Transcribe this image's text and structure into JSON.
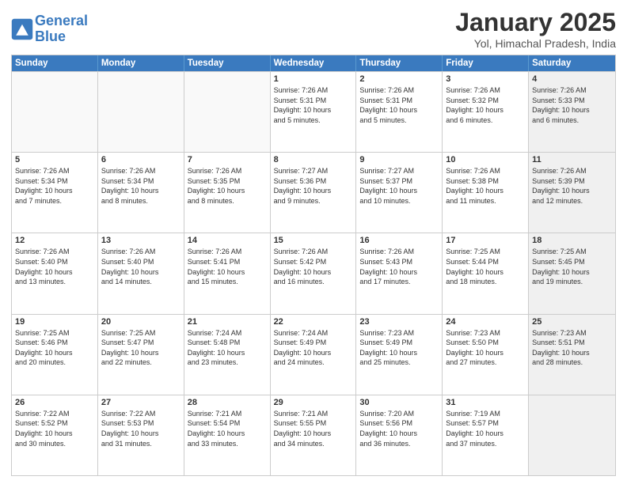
{
  "header": {
    "logo_line1": "General",
    "logo_line2": "Blue",
    "title": "January 2025",
    "subtitle": "Yol, Himachal Pradesh, India"
  },
  "weekdays": [
    "Sunday",
    "Monday",
    "Tuesday",
    "Wednesday",
    "Thursday",
    "Friday",
    "Saturday"
  ],
  "weeks": [
    [
      {
        "day": "",
        "info": "",
        "empty": true
      },
      {
        "day": "",
        "info": "",
        "empty": true
      },
      {
        "day": "",
        "info": "",
        "empty": true
      },
      {
        "day": "1",
        "info": "Sunrise: 7:26 AM\nSunset: 5:31 PM\nDaylight: 10 hours\nand 5 minutes."
      },
      {
        "day": "2",
        "info": "Sunrise: 7:26 AM\nSunset: 5:31 PM\nDaylight: 10 hours\nand 5 minutes."
      },
      {
        "day": "3",
        "info": "Sunrise: 7:26 AM\nSunset: 5:32 PM\nDaylight: 10 hours\nand 6 minutes."
      },
      {
        "day": "4",
        "info": "Sunrise: 7:26 AM\nSunset: 5:33 PM\nDaylight: 10 hours\nand 6 minutes.",
        "shaded": true
      }
    ],
    [
      {
        "day": "5",
        "info": "Sunrise: 7:26 AM\nSunset: 5:34 PM\nDaylight: 10 hours\nand 7 minutes."
      },
      {
        "day": "6",
        "info": "Sunrise: 7:26 AM\nSunset: 5:34 PM\nDaylight: 10 hours\nand 8 minutes."
      },
      {
        "day": "7",
        "info": "Sunrise: 7:26 AM\nSunset: 5:35 PM\nDaylight: 10 hours\nand 8 minutes."
      },
      {
        "day": "8",
        "info": "Sunrise: 7:27 AM\nSunset: 5:36 PM\nDaylight: 10 hours\nand 9 minutes."
      },
      {
        "day": "9",
        "info": "Sunrise: 7:27 AM\nSunset: 5:37 PM\nDaylight: 10 hours\nand 10 minutes."
      },
      {
        "day": "10",
        "info": "Sunrise: 7:26 AM\nSunset: 5:38 PM\nDaylight: 10 hours\nand 11 minutes."
      },
      {
        "day": "11",
        "info": "Sunrise: 7:26 AM\nSunset: 5:39 PM\nDaylight: 10 hours\nand 12 minutes.",
        "shaded": true
      }
    ],
    [
      {
        "day": "12",
        "info": "Sunrise: 7:26 AM\nSunset: 5:40 PM\nDaylight: 10 hours\nand 13 minutes."
      },
      {
        "day": "13",
        "info": "Sunrise: 7:26 AM\nSunset: 5:40 PM\nDaylight: 10 hours\nand 14 minutes."
      },
      {
        "day": "14",
        "info": "Sunrise: 7:26 AM\nSunset: 5:41 PM\nDaylight: 10 hours\nand 15 minutes."
      },
      {
        "day": "15",
        "info": "Sunrise: 7:26 AM\nSunset: 5:42 PM\nDaylight: 10 hours\nand 16 minutes."
      },
      {
        "day": "16",
        "info": "Sunrise: 7:26 AM\nSunset: 5:43 PM\nDaylight: 10 hours\nand 17 minutes."
      },
      {
        "day": "17",
        "info": "Sunrise: 7:25 AM\nSunset: 5:44 PM\nDaylight: 10 hours\nand 18 minutes."
      },
      {
        "day": "18",
        "info": "Sunrise: 7:25 AM\nSunset: 5:45 PM\nDaylight: 10 hours\nand 19 minutes.",
        "shaded": true
      }
    ],
    [
      {
        "day": "19",
        "info": "Sunrise: 7:25 AM\nSunset: 5:46 PM\nDaylight: 10 hours\nand 20 minutes."
      },
      {
        "day": "20",
        "info": "Sunrise: 7:25 AM\nSunset: 5:47 PM\nDaylight: 10 hours\nand 22 minutes."
      },
      {
        "day": "21",
        "info": "Sunrise: 7:24 AM\nSunset: 5:48 PM\nDaylight: 10 hours\nand 23 minutes."
      },
      {
        "day": "22",
        "info": "Sunrise: 7:24 AM\nSunset: 5:49 PM\nDaylight: 10 hours\nand 24 minutes."
      },
      {
        "day": "23",
        "info": "Sunrise: 7:23 AM\nSunset: 5:49 PM\nDaylight: 10 hours\nand 25 minutes."
      },
      {
        "day": "24",
        "info": "Sunrise: 7:23 AM\nSunset: 5:50 PM\nDaylight: 10 hours\nand 27 minutes."
      },
      {
        "day": "25",
        "info": "Sunrise: 7:23 AM\nSunset: 5:51 PM\nDaylight: 10 hours\nand 28 minutes.",
        "shaded": true
      }
    ],
    [
      {
        "day": "26",
        "info": "Sunrise: 7:22 AM\nSunset: 5:52 PM\nDaylight: 10 hours\nand 30 minutes."
      },
      {
        "day": "27",
        "info": "Sunrise: 7:22 AM\nSunset: 5:53 PM\nDaylight: 10 hours\nand 31 minutes."
      },
      {
        "day": "28",
        "info": "Sunrise: 7:21 AM\nSunset: 5:54 PM\nDaylight: 10 hours\nand 33 minutes."
      },
      {
        "day": "29",
        "info": "Sunrise: 7:21 AM\nSunset: 5:55 PM\nDaylight: 10 hours\nand 34 minutes."
      },
      {
        "day": "30",
        "info": "Sunrise: 7:20 AM\nSunset: 5:56 PM\nDaylight: 10 hours\nand 36 minutes."
      },
      {
        "day": "31",
        "info": "Sunrise: 7:19 AM\nSunset: 5:57 PM\nDaylight: 10 hours\nand 37 minutes."
      },
      {
        "day": "",
        "info": "",
        "empty": true,
        "shaded": true
      }
    ]
  ]
}
